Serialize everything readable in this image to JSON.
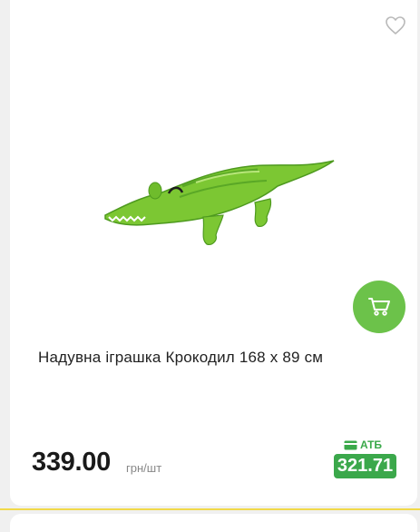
{
  "product": {
    "title": "Надувна іграшка Крокодил 168 х 89 см",
    "price": "339.00",
    "unit": "грн/шт",
    "promo_store": "АТБ",
    "promo_price": "321.71"
  },
  "icons": {
    "favorite": "heart-outline-icon",
    "cart": "cart-icon",
    "store": "card-icon"
  },
  "colors": {
    "accent": "#6cc24a",
    "promo": "#3ba84b"
  }
}
